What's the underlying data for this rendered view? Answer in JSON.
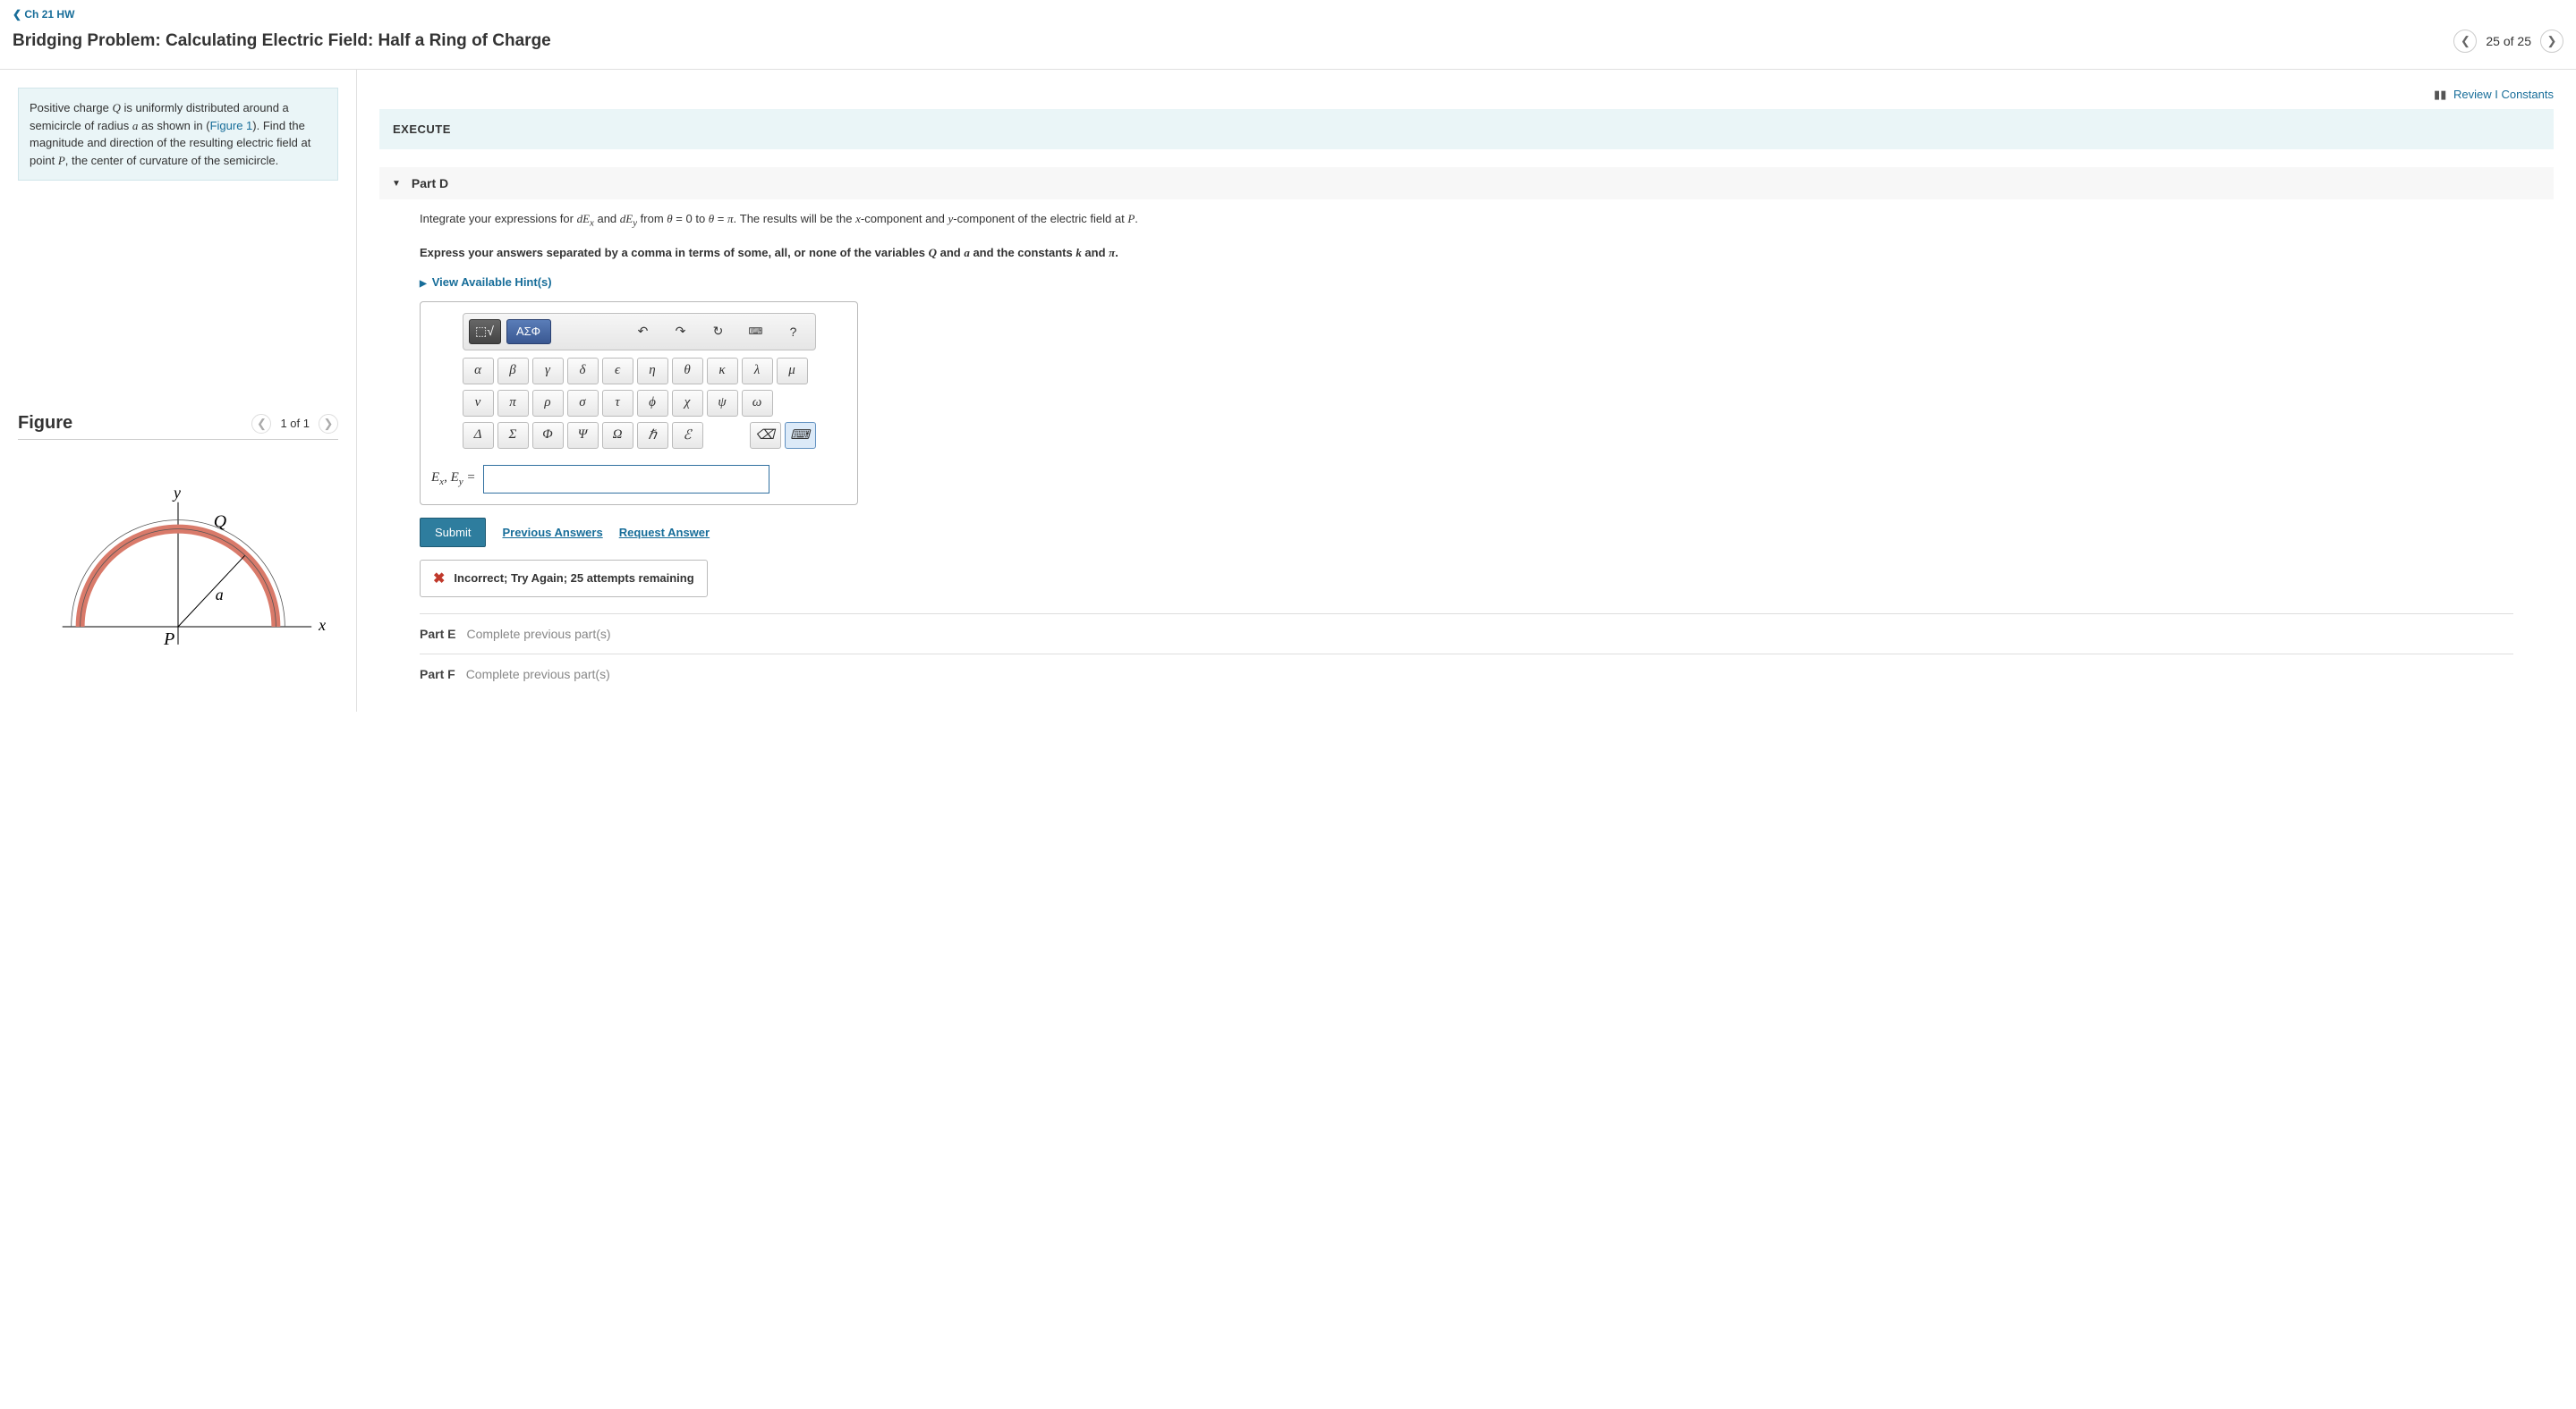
{
  "nav": {
    "back": "Ch 21 HW"
  },
  "title": "Bridging Problem: Calculating Electric Field: Half a Ring of Charge",
  "pager": {
    "text": "25 of 25"
  },
  "info": {
    "t1": "Positive charge ",
    "q": "Q",
    "t2": " is uniformly distributed around a semicircle of radius ",
    "a": "a",
    "t3": " as shown in (",
    "figlink": "Figure 1",
    "t4": "). Find the magnitude and direction of the resulting electric field at point ",
    "p": "P",
    "t5": ", the center of curvature of the semicircle."
  },
  "figure": {
    "heading": "Figure",
    "pager": "1 of 1",
    "labels": {
      "y": "y",
      "x": "x",
      "Q": "Q",
      "a": "a",
      "P": "P"
    }
  },
  "toplinks": {
    "review": "Review",
    "sep": " I ",
    "constants": "Constants"
  },
  "section": "EXECUTE",
  "partD": {
    "label": "Part D",
    "p1a": "Integrate your expressions for ",
    "p1b": "dEₓ",
    "p1c": " and ",
    "p1d": "dEᵧ",
    "p1e": " from ",
    "p1f": "θ = 0",
    "p1g": " to ",
    "p1h": "θ = π",
    "p1i": ". The results will be the ",
    "p1j": "x",
    "p1k": "-component and ",
    "p1l": "y",
    "p1m": "-component of the electric field at ",
    "p1n": "P",
    "p1o": ".",
    "p2a": "Express your answers separated by a comma in terms of some, all, or none of the variables ",
    "p2b": "Q",
    "p2c": " and ",
    "p2d": "a",
    "p2e": " and the constants ",
    "p2f": "k",
    "p2g": " and ",
    "p2h": "π",
    "p2i": ".",
    "hints": "View Available Hint(s)",
    "input_label": "Eₓ, Eᵧ =",
    "value": ""
  },
  "toolbar": {
    "templates": "⬚√",
    "greek_tab": "ΑΣΦ",
    "undo": "↶",
    "redo": "↷",
    "reset": "↻",
    "keyboard": "⌨",
    "help": "?"
  },
  "greek": {
    "row1": [
      "α",
      "β",
      "γ",
      "δ",
      "ϵ",
      "η",
      "θ",
      "κ",
      "λ",
      "μ"
    ],
    "row2": [
      "ν",
      "π",
      "ρ",
      "σ",
      "τ",
      "ϕ",
      "χ",
      "ψ",
      "ω"
    ],
    "row3": [
      "Δ",
      "Σ",
      "Φ",
      "Ψ",
      "Ω",
      "ℏ",
      "ℰ"
    ],
    "backspace": "⌫",
    "kbd": "⌨"
  },
  "actions": {
    "submit": "Submit",
    "prev": "Previous Answers",
    "req": "Request Answer"
  },
  "feedback": {
    "msg": "Incorrect; Try Again; 25 attempts remaining"
  },
  "partE": {
    "label": "Part E",
    "msg": "Complete previous part(s)"
  },
  "partF": {
    "label": "Part F",
    "msg": "Complete previous part(s)"
  }
}
